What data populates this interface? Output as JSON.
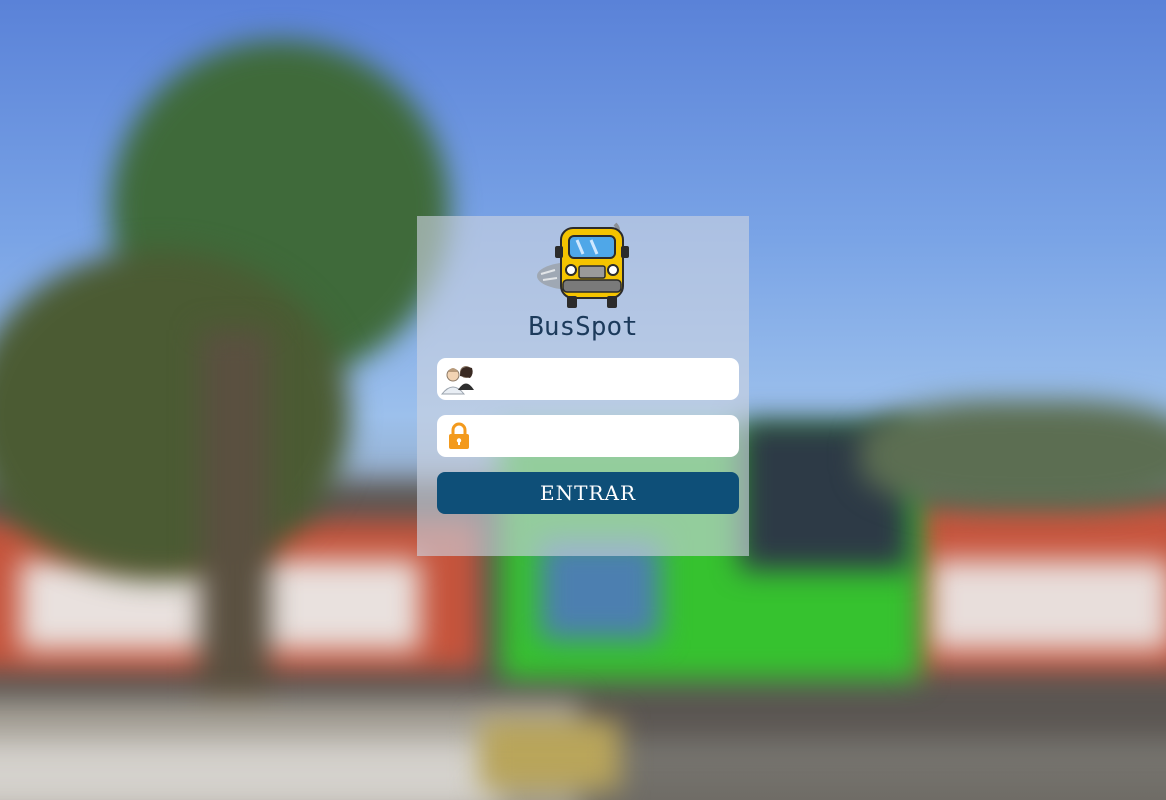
{
  "app": {
    "brand_name": "BusSpot"
  },
  "login": {
    "username": {
      "value": "",
      "placeholder": "",
      "icon": "users-icon"
    },
    "password": {
      "value": "",
      "placeholder": "",
      "icon": "lock-icon"
    },
    "submit_label": "ENTRAR"
  },
  "colors": {
    "button": "#0e4f78",
    "brand_text": "#1c3a5b",
    "panel": "rgba(205,212,225,0.62)",
    "bus_yellow": "#f5c400",
    "lock_orange": "#f39a1d"
  },
  "background": {
    "icon": "blurred-bus-terminal-photo"
  }
}
